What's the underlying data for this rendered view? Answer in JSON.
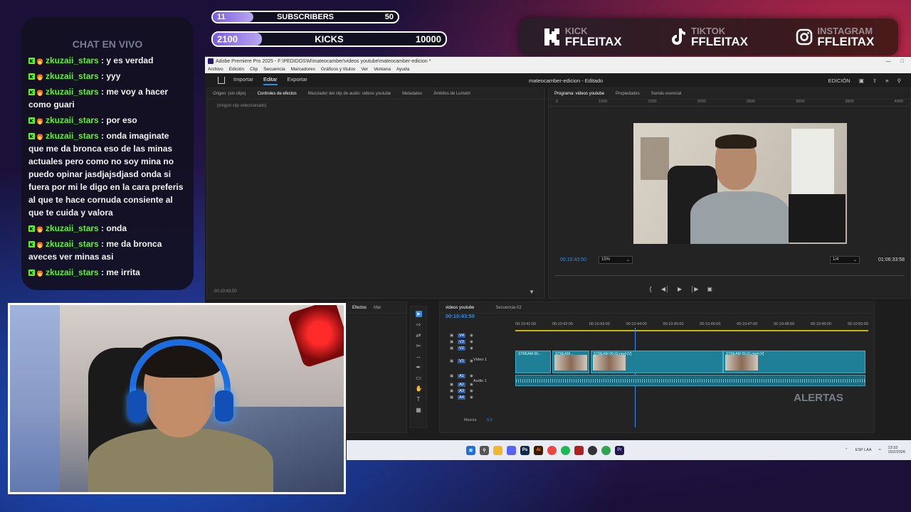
{
  "stats": {
    "subscribers": {
      "current": "11",
      "label": "SUBSCRIBERS",
      "goal": "50",
      "progress": 0.22
    },
    "kicks": {
      "current": "2100",
      "label": "KICKS",
      "goal": "10000",
      "progress": 0.21
    }
  },
  "social": [
    {
      "network": "KICK",
      "handle": "FFLEITAX",
      "icon": "kick-logo-icon"
    },
    {
      "network": "TIKTOK",
      "handle": "FFLEITAX",
      "icon": "tiktok-logo-icon"
    },
    {
      "network": "INSTAGRAM",
      "handle": "FFLEITAX",
      "icon": "instagram-logo-icon"
    }
  ],
  "chat": {
    "title": "CHAT EN VIVO",
    "messages": [
      {
        "user": "zkuzaii_stars",
        "text": " : y es verdad"
      },
      {
        "user": "zkuzaii_stars",
        "text": " : yyy"
      },
      {
        "user": "zkuzaii_stars",
        "text": " : me voy a hacer como guari"
      },
      {
        "user": "zkuzaii_stars",
        "text": " : por eso"
      },
      {
        "user": "zkuzaii_stars",
        "text": " : onda imaginate que me da bronca eso de las minas actuales pero como no soy mina no puedo opinar jasdjajsdjasd onda si fuera por mi le digo en la cara preferis al que te hace cornuda consiente al que te cuida y valora"
      },
      {
        "user": "zkuzaii_stars",
        "text": " : onda"
      },
      {
        "user": "zkuzaii_stars",
        "text": " : me da bronca aveces ver minas asi"
      },
      {
        "user": "zkuzaii_stars",
        "text": " : me irrita"
      }
    ]
  },
  "premiere": {
    "window_title": "Adobe Premiere Pro 2025 - F:\\PEDIDOS\\M\\mateocamber\\videos youtube\\mateocamber-edicion *",
    "menu": [
      "Archivo",
      "Edición",
      "Clip",
      "Secuencia",
      "Marcadores",
      "Gráficos y títulos",
      "Ver",
      "Ventana",
      "Ayuda"
    ],
    "app_tabs": [
      "Importar",
      "Editar",
      "Exportar"
    ],
    "doc_title": "mateocamber-edicion - Editado",
    "workspace": "EDICIÓN",
    "source_tabs": [
      "Origen: (sin clips)",
      "Controles de efectos",
      "Mezclador del clip de audio: videos youtube",
      "Metadatos",
      "Ámbitos de Lumetri"
    ],
    "no_clip": "(ningún clip seleccionado)",
    "source_time": "00:10:43:50",
    "program_tabs": [
      "Programa: videos youtube",
      "Propiedades",
      "Sonido esencial"
    ],
    "ruler_ticks": [
      "0",
      "1000",
      "1500",
      "2000",
      "2500",
      "3000",
      "3500",
      "4000"
    ],
    "program_time": "00:10:43:50",
    "zoom": "15%",
    "resolution": "1/4",
    "duration": "01:06:33:58",
    "project_tabs": [
      "Efectos",
      "Mar"
    ],
    "timeline_tabs": [
      "videos youtube",
      "Secuencia 02"
    ],
    "timeline_time": "00:10:43:50",
    "timecodes": [
      "00:10:41:00",
      "00:10:42:00",
      "00:10:43:00",
      "00:10:44:00",
      "00:10:45:00",
      "00:10:46:00",
      "00:10:47:00",
      "00:10:48:00",
      "00:10:49:00",
      "00:10:50:00"
    ],
    "tracks": [
      "V4",
      "V3",
      "V2",
      "V1",
      "A1",
      "A2",
      "A3",
      "A4"
    ],
    "video_track_label": "Vídeo 1",
    "audio_track_label": "Audio 1",
    "mix_label": "Mezcla",
    "mix_value": "0,0",
    "clips": [
      "STREAM 09...",
      "STREAM...",
      "STREAM 09.02.mp4 [V]",
      "STREAM 09.02.mp4 [V]"
    ],
    "taskbar_lang": "ESP LAA",
    "taskbar_time": "13:33",
    "taskbar_date": "15/2/2026"
  },
  "alerts_label": "ALERTAS"
}
